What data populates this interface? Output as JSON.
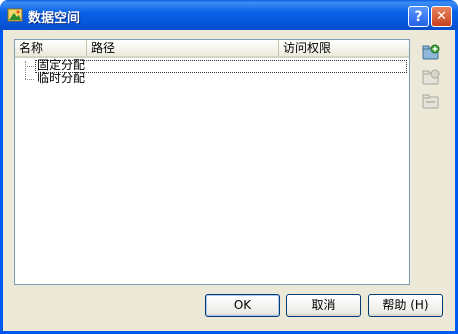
{
  "window": {
    "title": "数据空间",
    "help_glyph": "?",
    "close_glyph": "✕"
  },
  "list": {
    "columns": [
      "名称",
      "路径",
      "访问权限"
    ],
    "rows": [
      {
        "name": "固定分配",
        "path": "",
        "access": ""
      },
      {
        "name": "临时分配",
        "path": "",
        "access": ""
      }
    ],
    "selected_index": 0
  },
  "side_buttons": [
    {
      "icon": "folder-add-icon",
      "enabled": true
    },
    {
      "icon": "folder-edit-icon",
      "enabled": false
    },
    {
      "icon": "folder-remove-icon",
      "enabled": false
    }
  ],
  "buttons": {
    "ok": "OK",
    "cancel": "取消",
    "help": "帮助 (H)"
  },
  "colors": {
    "titlebar": "#0058ee",
    "dialog_bg": "#ece9d8",
    "list_border": "#7f9db9"
  }
}
